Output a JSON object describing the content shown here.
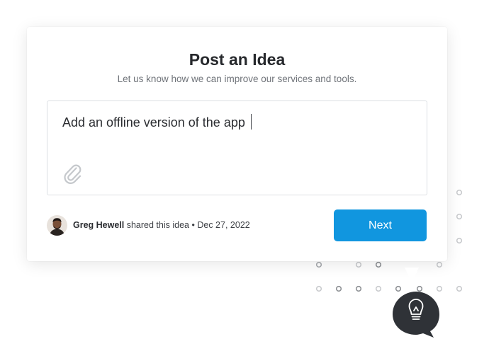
{
  "card": {
    "title": "Post an Idea",
    "subtitle": "Let us know how we can improve our services and tools."
  },
  "idea": {
    "text": "Add an offline version of the app"
  },
  "author": {
    "name": "Greg Hewell",
    "action": "shared this idea",
    "separator": "•",
    "date": "Dec 27, 2022"
  },
  "actions": {
    "next_label": "Next"
  },
  "colors": {
    "accent": "#1196df",
    "bubble": "#2f3237",
    "dots": "#c7c9cc"
  },
  "icons": [
    "paperclip-icon",
    "lightbulb-icon"
  ]
}
